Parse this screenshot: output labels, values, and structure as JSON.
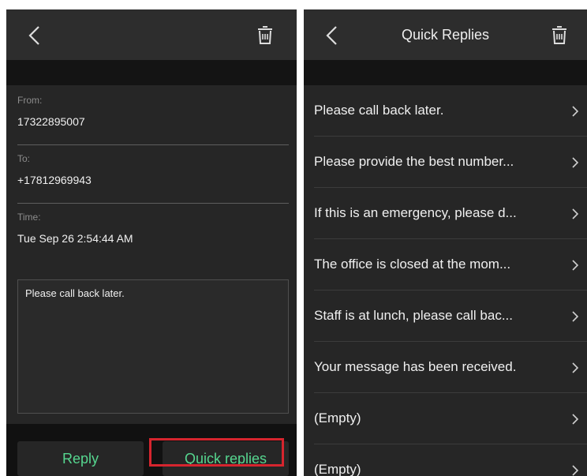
{
  "left_panel": {
    "fields": [
      {
        "label": "From:",
        "value": "17322895007"
      },
      {
        "label": "To:",
        "value": "+17812969943"
      },
      {
        "label": "Time:",
        "value": "Tue Sep 26 2:54:44 AM"
      }
    ],
    "message": "Please call back later.",
    "buttons": {
      "reply": "Reply",
      "quick_replies": "Quick replies"
    }
  },
  "right_panel": {
    "title": "Quick Replies",
    "items": [
      "Please call back later.",
      "Please provide the best number...",
      "If this is an emergency, please d...",
      "The office is closed at the mom...",
      "Staff is at lunch, please call bac...",
      "Your message has been received.",
      "(Empty)",
      "(Empty)"
    ]
  },
  "icons": {
    "back": "chevron-left-icon",
    "delete": "trash-icon",
    "item_arrow": "chevron-right-icon"
  },
  "colors": {
    "accent": "#56d68f",
    "highlight": "#d6252e",
    "background": "#262626"
  }
}
